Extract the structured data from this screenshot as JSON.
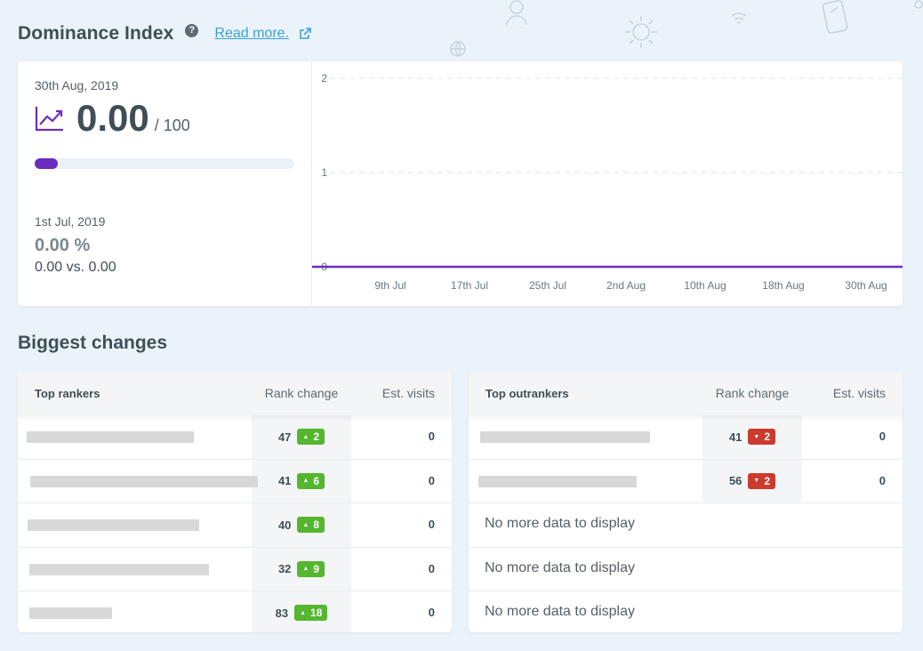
{
  "header": {
    "title": "Dominance Index",
    "help_icon_glyph": "?",
    "read_more": "Read more."
  },
  "dominance": {
    "current_date": "30th Aug, 2019",
    "score": "0.00",
    "score_max": "/ 100",
    "progress_fraction": 0.09,
    "compare_date": "1st Jul, 2019",
    "change_percent": "0.00 %",
    "comparison": "0.00 vs. 0.00"
  },
  "chart_data": {
    "type": "line",
    "x": [
      "9th Jul",
      "17th Jul",
      "25th Jul",
      "2nd Aug",
      "10th Aug",
      "18th Aug",
      "30th Aug"
    ],
    "yticks": [
      "0",
      "1",
      "2"
    ],
    "ylim": [
      0,
      2
    ],
    "series": [
      {
        "values": [
          0,
          0,
          0,
          0,
          0,
          0,
          0
        ],
        "color": "#6a2dbf"
      }
    ],
    "grid": true
  },
  "biggest_changes": {
    "title": "Biggest changes",
    "top_rankers": {
      "header": "Top rankers",
      "rank_header": "Rank change",
      "visits_header": "Est. visits",
      "rows": [
        {
          "rank": "47",
          "change": "2",
          "direction": "up",
          "visits": "0"
        },
        {
          "rank": "41",
          "change": "6",
          "direction": "up",
          "visits": "0"
        },
        {
          "rank": "40",
          "change": "8",
          "direction": "up",
          "visits": "0"
        },
        {
          "rank": "32",
          "change": "9",
          "direction": "up",
          "visits": "0"
        },
        {
          "rank": "83",
          "change": "18",
          "direction": "up",
          "visits": "0"
        }
      ]
    },
    "top_outrankers": {
      "header": "Top outrankers",
      "rank_header": "Rank change",
      "visits_header": "Est. visits",
      "rows": [
        {
          "rank": "41",
          "change": "2",
          "direction": "down",
          "visits": "0"
        },
        {
          "rank": "56",
          "change": "2",
          "direction": "down",
          "visits": "0"
        }
      ],
      "empty_rows": [
        "No more data to display",
        "No more data to display",
        "No more data to display"
      ]
    }
  },
  "colors": {
    "accent": "#6a2dbf",
    "link": "#3a9fd8",
    "badge_up": "#55b630",
    "badge_down": "#cc3a2e"
  }
}
